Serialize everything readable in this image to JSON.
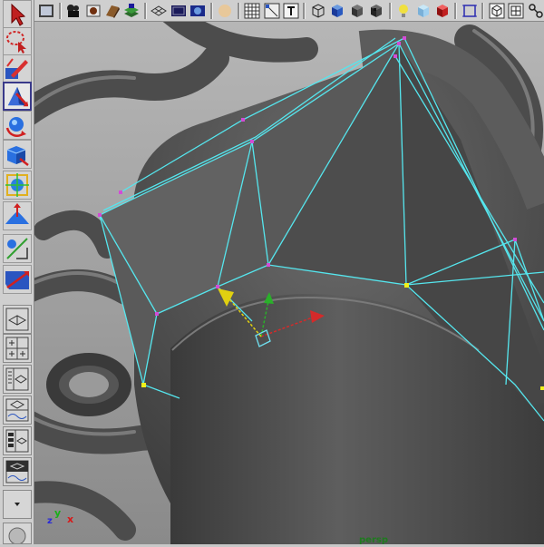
{
  "viewport": {
    "camera_label": "persp",
    "axis_x": "x",
    "axis_y": "y",
    "axis_z": "z"
  },
  "colors": {
    "wire": "#55e6ee",
    "vertex": "#d24cd6",
    "selected_vertex": "#f0f01a",
    "move_x": "#d42a2a",
    "move_y": "#2ab02a",
    "move_pivot": "#e0d010",
    "background": "#a9a9a9",
    "panel": "#cfcfcf"
  },
  "shelf_icons": [
    "render-view-icon",
    "clapper-icon",
    "hypershade-icon",
    "render-globals-icon",
    "layer-icon",
    "grid-snap-icon",
    "display-shaded-icon",
    "camera-icon",
    "sphere-icon",
    "checker-icon",
    "uv-snap-icon",
    "text-icon",
    "wire-cube-icon",
    "blue-cube-icon",
    "grey-cube-icon",
    "dark-cube-icon",
    "light-bulb-icon",
    "ice-cube-icon",
    "red-cube-icon",
    "frame-selected-icon",
    "wire-box-icon",
    "grid-box-icon",
    "connect-icon"
  ],
  "toolbox_icons": [
    "select-tool-icon",
    "lasso-tool-icon",
    "paint-select-icon",
    "move-tool-icon",
    "rotate-tool-icon",
    "scale-tool-icon",
    "universal-manip-icon",
    "soft-mod-icon",
    "show-manip-icon",
    "last-tool-icon"
  ],
  "layout_icons": [
    "single-pane-icon",
    "four-pane-icon",
    "outliner-persp-icon",
    "graph-persp-icon",
    "hypershade-persp-icon",
    "persp-graph-icon",
    "layout-dropdown-icon"
  ]
}
